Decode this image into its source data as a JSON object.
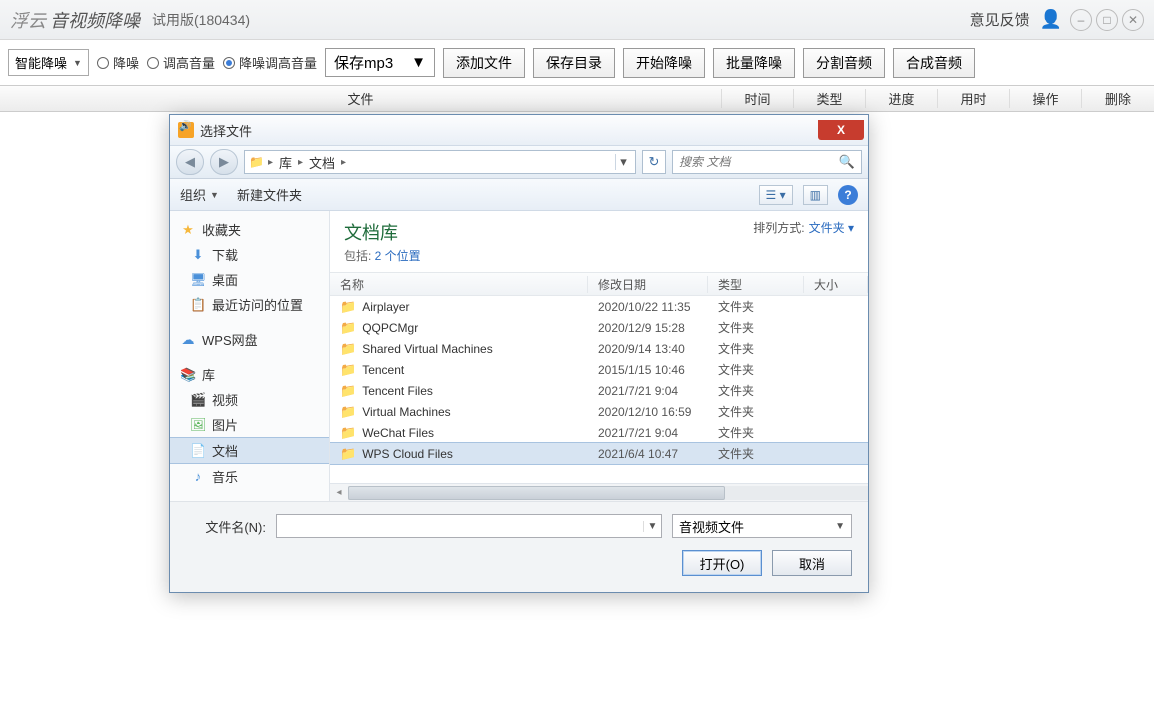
{
  "titlebar": {
    "logo": "浮云",
    "appname": "音视频降噪",
    "trial": "试用版(180434)",
    "feedback": "意见反馈"
  },
  "toolbar": {
    "mode_dropdown": "智能降噪",
    "radio1": "降噪",
    "radio2": "调高音量",
    "radio3": "降噪调高音量",
    "save_format": "保存mp3",
    "add_file": "添加文件",
    "save_dir": "保存目录",
    "start": "开始降噪",
    "batch": "批量降噪",
    "split": "分割音频",
    "merge": "合成音频"
  },
  "table_headers": {
    "file": "文件",
    "time": "时间",
    "type": "类型",
    "progress": "进度",
    "elapsed": "用时",
    "action": "操作",
    "delete": "删除"
  },
  "dialog": {
    "title": "选择文件",
    "path_lib": "库",
    "path_doc": "文档",
    "search_placeholder": "搜索 文档",
    "organize": "组织",
    "new_folder": "新建文件夹",
    "lib_title": "文档库",
    "lib_sub_prefix": "包括: ",
    "lib_sub_link": "2 个位置",
    "sort_label": "排列方式:",
    "sort_value": "文件夹",
    "col_name": "名称",
    "col_date": "修改日期",
    "col_type": "类型",
    "col_size": "大小",
    "filename_label": "文件名(N):",
    "filter": "音视频文件",
    "open_btn": "打开(O)",
    "cancel_btn": "取消"
  },
  "sidebar": {
    "favorites": "收藏夹",
    "downloads": "下载",
    "desktop": "桌面",
    "recent": "最近访问的位置",
    "wps": "WPS网盘",
    "library": "库",
    "video": "视频",
    "pictures": "图片",
    "documents": "文档",
    "music": "音乐"
  },
  "files": [
    {
      "name": "Airplayer",
      "date": "2020/10/22 11:35",
      "type": "文件夹"
    },
    {
      "name": "QQPCMgr",
      "date": "2020/12/9 15:28",
      "type": "文件夹"
    },
    {
      "name": "Shared Virtual Machines",
      "date": "2020/9/14 13:40",
      "type": "文件夹"
    },
    {
      "name": "Tencent",
      "date": "2015/1/15 10:46",
      "type": "文件夹"
    },
    {
      "name": "Tencent Files",
      "date": "2021/7/21 9:04",
      "type": "文件夹"
    },
    {
      "name": "Virtual Machines",
      "date": "2020/12/10 16:59",
      "type": "文件夹"
    },
    {
      "name": "WeChat Files",
      "date": "2021/7/21 9:04",
      "type": "文件夹"
    },
    {
      "name": "WPS Cloud Files",
      "date": "2021/6/4 10:47",
      "type": "文件夹"
    }
  ]
}
